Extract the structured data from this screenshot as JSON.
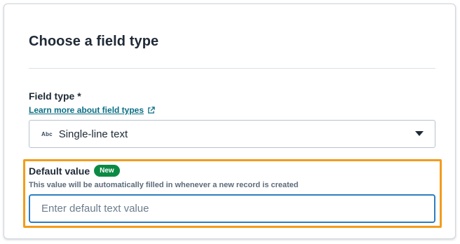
{
  "panel": {
    "title": "Choose a field type"
  },
  "field_type": {
    "label": "Field type *",
    "learn_more_link": "Learn more about field types",
    "icon": "external-link-icon",
    "select": {
      "type_icon_text": "Abc",
      "selected_value": "Single-line text",
      "caret_icon": "caret-down-icon"
    }
  },
  "default_value": {
    "label": "Default value",
    "badge": "New",
    "helper_text": "This value will be automatically filled in whenever a new record is created",
    "input": {
      "value": "",
      "placeholder": "Enter default text value"
    }
  },
  "colors": {
    "highlight": "#f39c1b",
    "link": "#0a6e84",
    "badge": "#0b8a43",
    "input_focus": "#2d7ec1"
  }
}
